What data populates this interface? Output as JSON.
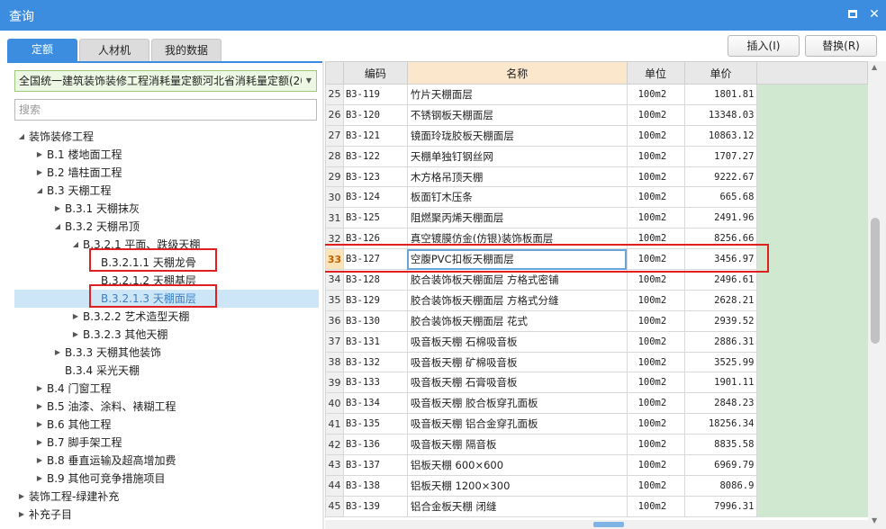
{
  "window": {
    "title": "查询"
  },
  "tabs": [
    {
      "label": "定额",
      "active": true
    },
    {
      "label": "人材机",
      "active": false
    },
    {
      "label": "我的数据",
      "active": false
    }
  ],
  "actions": {
    "insert": "插入(I)",
    "replace": "替换(R)"
  },
  "left": {
    "library": "全国统一建筑装饰装修工程消耗量定额河北省消耗量定额(2012)",
    "search_placeholder": "搜索"
  },
  "tree": [
    {
      "label": "装饰装修工程",
      "toggle": "expanded"
    },
    {
      "label": "B.1 楼地面工程",
      "toggle": "collapsed"
    },
    {
      "label": "B.2 墙柱面工程",
      "toggle": "collapsed"
    },
    {
      "label": "B.3 天棚工程",
      "toggle": "expanded"
    },
    {
      "label": "B.3.1 天棚抹灰",
      "toggle": "collapsed"
    },
    {
      "label": "B.3.2 天棚吊顶",
      "toggle": "expanded"
    },
    {
      "label": "B.3.2.1 平面、跌级天棚",
      "toggle": "expanded"
    },
    {
      "label": "B.3.2.1.1 天棚龙骨",
      "toggle": "none"
    },
    {
      "label": "B.3.2.1.2 天棚基层",
      "toggle": "none"
    },
    {
      "label": "B.3.2.1.3 天棚面层",
      "toggle": "none",
      "selected": true
    },
    {
      "label": "B.3.2.2 艺术造型天棚",
      "toggle": "collapsed"
    },
    {
      "label": "B.3.2.3 其他天棚",
      "toggle": "collapsed"
    },
    {
      "label": "B.3.3 天棚其他装饰",
      "toggle": "collapsed"
    },
    {
      "label": "B.3.4 采光天棚",
      "toggle": "none"
    },
    {
      "label": "B.4 门窗工程",
      "toggle": "collapsed"
    },
    {
      "label": "B.5 油漆、涂料、裱糊工程",
      "toggle": "collapsed"
    },
    {
      "label": "B.6 其他工程",
      "toggle": "collapsed"
    },
    {
      "label": "B.7 脚手架工程",
      "toggle": "collapsed"
    },
    {
      "label": "B.8 垂直运输及超高增加费",
      "toggle": "collapsed"
    },
    {
      "label": "B.9 其他可竞争措施项目",
      "toggle": "collapsed"
    },
    {
      "label": "装饰工程-绿建补充",
      "toggle": "collapsed"
    },
    {
      "label": "补充子目",
      "toggle": "collapsed"
    }
  ],
  "grid": {
    "headers": {
      "code": "编码",
      "name": "名称",
      "unit": "单位",
      "price": "单价"
    },
    "rows": [
      {
        "no": "25",
        "code": "B3-119",
        "name": "竹片天棚面层",
        "unit": "100m2",
        "price": "1801.81"
      },
      {
        "no": "26",
        "code": "B3-120",
        "name": "不锈钢板天棚面层",
        "unit": "100m2",
        "price": "13348.03"
      },
      {
        "no": "27",
        "code": "B3-121",
        "name": "镜面玲珑胶板天棚面层",
        "unit": "100m2",
        "price": "10863.12"
      },
      {
        "no": "28",
        "code": "B3-122",
        "name": "天棚单独钉钢丝网",
        "unit": "100m2",
        "price": "1707.27"
      },
      {
        "no": "29",
        "code": "B3-123",
        "name": "木方格吊顶天棚",
        "unit": "100m2",
        "price": "9222.67"
      },
      {
        "no": "30",
        "code": "B3-124",
        "name": "板面钉木压条",
        "unit": "100m2",
        "price": "665.68"
      },
      {
        "no": "31",
        "code": "B3-125",
        "name": "阻燃聚丙烯天棚面层",
        "unit": "100m2",
        "price": "2491.96"
      },
      {
        "no": "32",
        "code": "B3-126",
        "name": "真空镀膜仿金(仿银)装饰板面层",
        "unit": "100m2",
        "price": "8256.66"
      },
      {
        "no": "33",
        "code": "B3-127",
        "name": "空腹PVC扣板天棚面层",
        "unit": "100m2",
        "price": "3456.97",
        "selected": true
      },
      {
        "no": "34",
        "code": "B3-128",
        "name": "胶合装饰板天棚面层 方格式密铺",
        "unit": "100m2",
        "price": "2496.61"
      },
      {
        "no": "35",
        "code": "B3-129",
        "name": "胶合装饰板天棚面层 方格式分缝",
        "unit": "100m2",
        "price": "2628.21"
      },
      {
        "no": "36",
        "code": "B3-130",
        "name": "胶合装饰板天棚面层 花式",
        "unit": "100m2",
        "price": "2939.52"
      },
      {
        "no": "37",
        "code": "B3-131",
        "name": "吸音板天棚 石棉吸音板",
        "unit": "100m2",
        "price": "2886.31"
      },
      {
        "no": "38",
        "code": "B3-132",
        "name": "吸音板天棚 矿棉吸音板",
        "unit": "100m2",
        "price": "3525.99"
      },
      {
        "no": "39",
        "code": "B3-133",
        "name": "吸音板天棚 石膏吸音板",
        "unit": "100m2",
        "price": "1901.11"
      },
      {
        "no": "40",
        "code": "B3-134",
        "name": "吸音板天棚 胶合板穿孔面板",
        "unit": "100m2",
        "price": "2848.23"
      },
      {
        "no": "41",
        "code": "B3-135",
        "name": "吸音板天棚 铝合金穿孔面板",
        "unit": "100m2",
        "price": "18256.34"
      },
      {
        "no": "42",
        "code": "B3-136",
        "name": "吸音板天棚 隔音板",
        "unit": "100m2",
        "price": "8835.58"
      },
      {
        "no": "43",
        "code": "B3-137",
        "name": "铝板天棚 600×600",
        "unit": "100m2",
        "price": "6969.79"
      },
      {
        "no": "44",
        "code": "B3-138",
        "name": "铝板天棚 1200×300",
        "unit": "100m2",
        "price": "8086.9"
      },
      {
        "no": "45",
        "code": "B3-139",
        "name": "铝合金板天棚 闭缝",
        "unit": "100m2",
        "price": "7996.31"
      }
    ]
  },
  "colors": {
    "accent": "#3c8de0",
    "highlight_box": "#e02020",
    "tree_selected": "#cde6f7",
    "side_panel": "#cfe8cf"
  },
  "icons": {
    "close": "close-icon",
    "maximize": "maximize-icon",
    "expanded": "triangle-down-icon",
    "collapsed": "triangle-right-icon"
  }
}
